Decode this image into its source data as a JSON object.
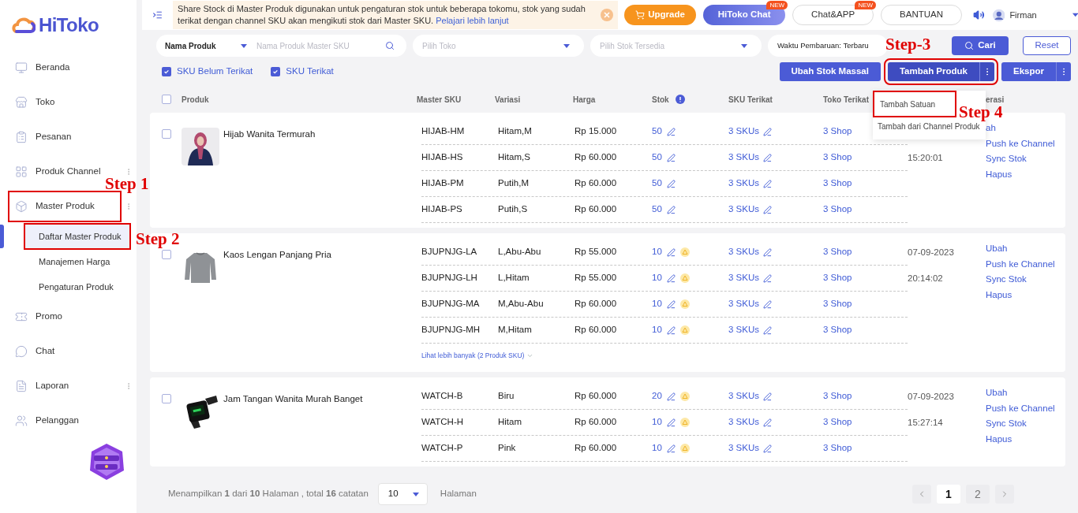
{
  "sidebar": {
    "logo": "HiToko",
    "items": [
      {
        "label": "Beranda",
        "menu": false,
        "highlighted": false
      },
      {
        "label": "Toko",
        "menu": false,
        "highlighted": false
      },
      {
        "label": "Pesanan",
        "menu": false,
        "highlighted": false
      },
      {
        "label": "Produk Channel",
        "menu": true,
        "highlighted": false
      },
      {
        "label": "Master Produk",
        "menu": true,
        "highlighted": true,
        "children": [
          {
            "label": "Daftar Master Produk",
            "selected": true,
            "highlighted": true
          },
          {
            "label": "Manajemen Harga",
            "selected": false,
            "highlighted": false
          },
          {
            "label": "Pengaturan Produk",
            "selected": false,
            "highlighted": false
          }
        ]
      },
      {
        "label": "Promo",
        "menu": false,
        "highlighted": false
      },
      {
        "label": "Chat",
        "menu": false,
        "highlighted": false
      },
      {
        "label": "Laporan",
        "menu": true,
        "highlighted": false
      },
      {
        "label": "Pelanggan",
        "menu": false,
        "highlighted": false
      }
    ]
  },
  "top_bar": {
    "notice": "Share Stock di Master Produk digunakan untuk pengaturan stok untuk beberapa tokomu, stok yang sudah terikat dengan channel SKU akan mengikuti stok dari Master SKU.",
    "notice_link": "Pelajari lebih lanjut",
    "buttons": [
      {
        "label": "Upgrade",
        "kind": "upgrade"
      },
      {
        "label": "HiToko Chat",
        "kind": "chat",
        "badge": "NEW"
      },
      {
        "label": "Chat&APP",
        "kind": "outline",
        "badge": "NEW"
      },
      {
        "label": "BANTUAN",
        "kind": "outline"
      }
    ],
    "user": "Firman"
  },
  "filters": {
    "search_by": "Nama Produk",
    "search_placeholder": "Nama Produk Master SKU",
    "selects": [
      {
        "placeholder": "Pilih Toko"
      },
      {
        "placeholder": "Pilih Stok Tersedia"
      }
    ],
    "sort": "Waktu Pembaruan: Terbaru",
    "search_button": "Cari",
    "reset_button": "Reset"
  },
  "sku_filters": [
    {
      "label": "SKU Belum Terikat",
      "checked": true
    },
    {
      "label": "SKU Terikat",
      "checked": true
    }
  ],
  "actions": [
    {
      "label": "Ubah Stok Massal",
      "menu": false,
      "highlighted": false
    },
    {
      "label": "Tambah Produk",
      "menu": true,
      "highlighted": true
    },
    {
      "label": "Ekspor",
      "menu": true,
      "highlighted": false
    }
  ],
  "dropdown": [
    {
      "label": "Tambah Satuan",
      "highlighted": true
    },
    {
      "label": "Tambah dari Channel Produk",
      "highlighted": false
    }
  ],
  "table": {
    "select_all": false,
    "columns": [
      "Produk",
      "Master SKU",
      "Variasi",
      "Harga",
      "Stok",
      "SKU Terikat",
      "Toko Terikat",
      "erasi"
    ],
    "products": [
      {
        "name": "Hijab Wanita Termurah",
        "checked": false,
        "time": "15:20:01",
        "actions": [
          "ah",
          "Push ke Channel",
          "Sync Stok",
          "Hapus"
        ],
        "variants": [
          {
            "sku": "HIJAB-HM",
            "variation": "Hitam,M",
            "price": "Rp 15.000",
            "stock": "50",
            "warning": false,
            "linked": "3 SKUs",
            "shops": "3 Shop"
          },
          {
            "sku": "HIJAB-HS",
            "variation": "Hitam,S",
            "price": "Rp 60.000",
            "stock": "50",
            "warning": false,
            "linked": "3 SKUs",
            "shops": "3 Shop"
          },
          {
            "sku": "HIJAB-PM",
            "variation": "Putih,M",
            "price": "Rp 60.000",
            "stock": "50",
            "warning": false,
            "linked": "3 SKUs",
            "shops": "3 Shop"
          },
          {
            "sku": "HIJAB-PS",
            "variation": "Putih,S",
            "price": "Rp 60.000",
            "stock": "50",
            "warning": false,
            "linked": "3 SKUs",
            "shops": "3 Shop"
          }
        ]
      },
      {
        "name": "Kaos Lengan Panjang Pria",
        "checked": false,
        "date": "07-09-2023",
        "time": "20:14:02",
        "actions": [
          "Ubah",
          "Push ke Channel",
          "Sync Stok",
          "Hapus"
        ],
        "more": "Lihat lebih banyak (2 Produk SKU)",
        "variants": [
          {
            "sku": "BJUPNJG-LA",
            "variation": "L,Abu-Abu",
            "price": "Rp 55.000",
            "stock": "10",
            "warning": true,
            "linked": "3 SKUs",
            "shops": "3 Shop"
          },
          {
            "sku": "BJUPNJG-LH",
            "variation": "L,Hitam",
            "price": "Rp 55.000",
            "stock": "10",
            "warning": true,
            "linked": "3 SKUs",
            "shops": "3 Shop"
          },
          {
            "sku": "BJUPNJG-MA",
            "variation": "M,Abu-Abu",
            "price": "Rp 60.000",
            "stock": "10",
            "warning": true,
            "linked": "3 SKUs",
            "shops": "3 Shop"
          },
          {
            "sku": "BJUPNJG-MH",
            "variation": "M,Hitam",
            "price": "Rp 60.000",
            "stock": "10",
            "warning": true,
            "linked": "3 SKUs",
            "shops": "3 Shop"
          }
        ]
      },
      {
        "name": "Jam Tangan Wanita Murah Banget",
        "checked": false,
        "date": "07-09-2023",
        "time": "15:27:14",
        "actions": [
          "Ubah",
          "Push ke Channel",
          "Sync Stok",
          "Hapus"
        ],
        "variants": [
          {
            "sku": "WATCH-B",
            "variation": "Biru",
            "price": "Rp 60.000",
            "stock": "20",
            "warning": true,
            "linked": "3 SKUs",
            "shops": "3 Shop"
          },
          {
            "sku": "WATCH-H",
            "variation": "Hitam",
            "price": "Rp 60.000",
            "stock": "10",
            "warning": true,
            "linked": "3 SKUs",
            "shops": "3 Shop"
          },
          {
            "sku": "WATCH-P",
            "variation": "Pink",
            "price": "Rp 60.000",
            "stock": "10",
            "warning": true,
            "linked": "3 SKUs",
            "shops": "3 Shop"
          }
        ]
      }
    ]
  },
  "footer": {
    "summary": "Menampilkan **1** dari **10** Halaman , total **16** catatan",
    "page_size": "10",
    "page_size_suffix": "Halaman",
    "pages": [
      {
        "label": "1",
        "selected": true
      },
      {
        "label": "2",
        "selected": false
      }
    ]
  },
  "annotations": [
    "Step 1",
    "Step 2",
    "Step-3",
    "Step 4"
  ]
}
